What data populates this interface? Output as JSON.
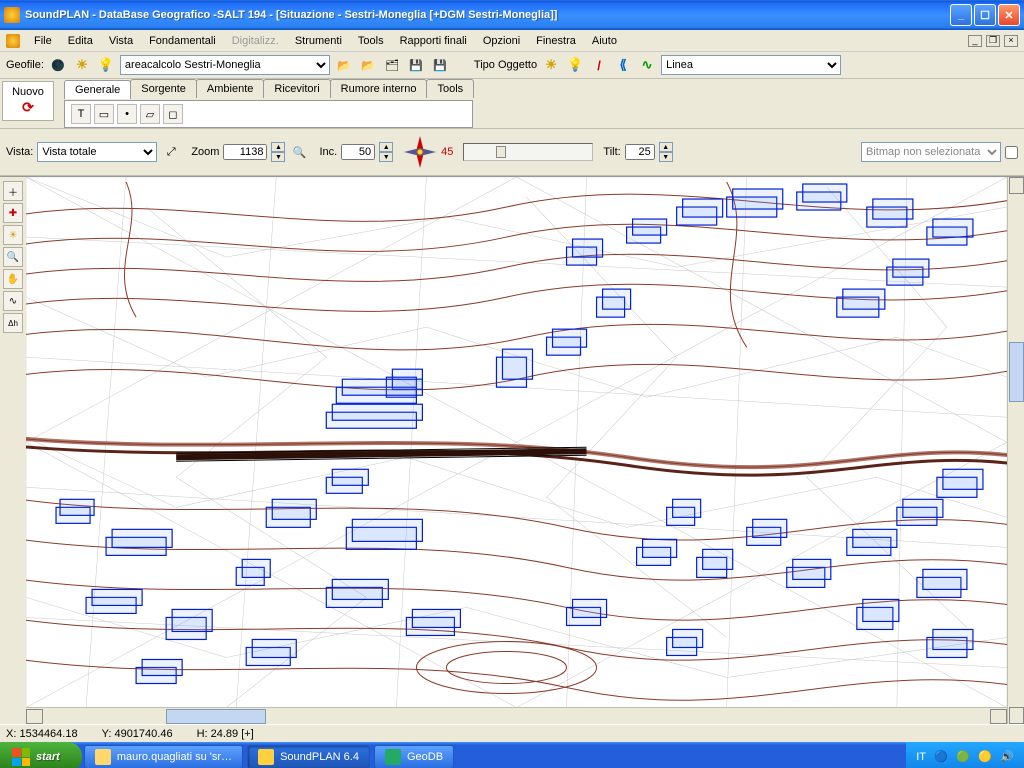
{
  "window": {
    "title": "SoundPLAN - DataBase Geografico -SALT 194 - [Situazione - Sestri-Moneglia [+DGM Sestri-Moneglia]]"
  },
  "menu": {
    "items": [
      "File",
      "Edita",
      "Vista",
      "Fondamentali",
      "Digitalizz.",
      "Strumenti",
      "Tools",
      "Rapporti finali",
      "Opzioni",
      "Finestra",
      "Aiuto"
    ]
  },
  "toolbar1": {
    "geofile_label": "Geofile:",
    "geofile_value": "areacalcolo Sestri-Moneglia",
    "tipo_label": "Tipo Oggetto",
    "tipo_value": "Linea"
  },
  "nuovo": {
    "label": "Nuovo"
  },
  "tabs": {
    "items": [
      "Generale",
      "Sorgente",
      "Ambiente",
      "Ricevitori",
      "Rumore interno",
      "Tools"
    ],
    "active": 0
  },
  "view": {
    "vista_label": "Vista:",
    "vista_value": "Vista totale",
    "zoom_label": "Zoom",
    "zoom_value": "1138",
    "inc_label": "Inc.",
    "inc_value": "50",
    "angle": "45",
    "tilt_label": "Tilt:",
    "tilt_value": "25",
    "bitmap_placeholder": "Bitmap non selezionata"
  },
  "lefttools": {
    "items": [
      "plus",
      "plus-red",
      "sun",
      "q",
      "hand",
      "curve",
      "dh"
    ]
  },
  "status": {
    "x_label": "X:",
    "x_value": "1534464.18",
    "y_label": "Y:",
    "y_value": "4901740.46",
    "h_label": "H:",
    "h_value": "24.89 [+]"
  },
  "taskbar": {
    "start": "start",
    "items": [
      {
        "label": "mauro.quagliati su 'sr…"
      },
      {
        "label": "SoundPLAN 6.4"
      },
      {
        "label": "GeoDB"
      }
    ],
    "lang": "IT"
  }
}
